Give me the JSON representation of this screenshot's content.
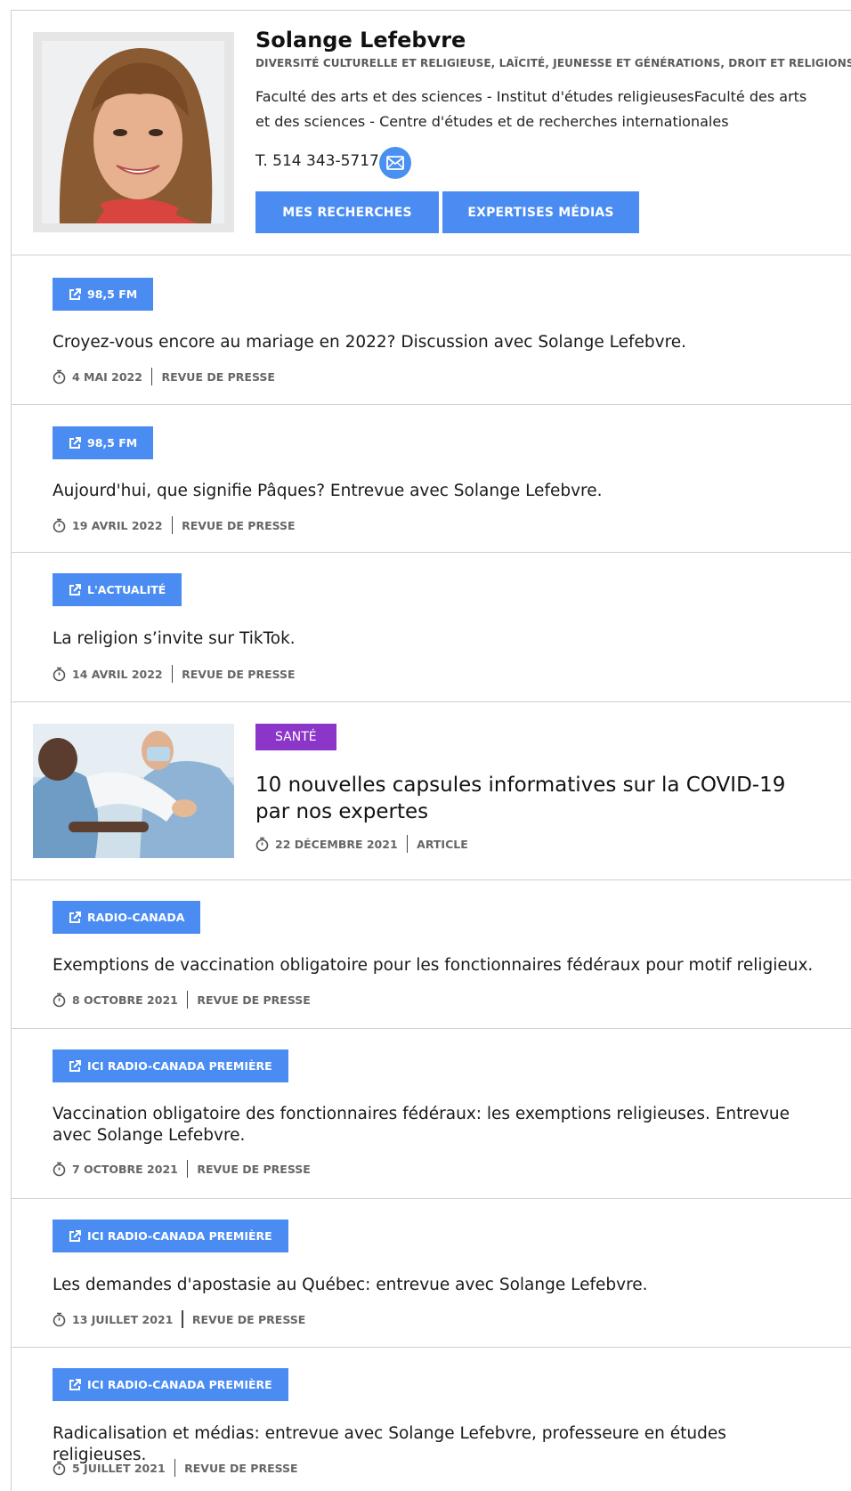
{
  "profile": {
    "name": "Solange Lefebvre",
    "expertise": "DIVERSITÉ CULTURELLE ET RELIGIEUSE, LAÏCITÉ, JEUNESSE ET GÉNÉRATIONS, DROIT ET RELIGIONS",
    "affiliation": "Faculté des arts et des sciences - Institut d'études religieusesFaculté des arts et des sciences - Centre d'études et de recherches internationales",
    "phone": "T. 514 343-5717",
    "mail_icon": "envelope-icon",
    "buttons": {
      "research": "MES RECHERCHES",
      "media": "EXPERTISES MÉDIAS"
    }
  },
  "colors": {
    "accent_blue": "#4a8cf2",
    "sante_purple": "#8b35c9"
  },
  "items": [
    {
      "source": "98,5 FM",
      "title": "Croyez-vous encore au mariage en 2022? Discussion avec Solange Lefebvre.",
      "date": "4 MAI 2022",
      "type": "REVUE DE PRESSE"
    },
    {
      "source": "98,5 FM",
      "title": "Aujourd'hui, que signifie Pâques? Entrevue avec Solange Lefebvre.",
      "date": "19 AVRIL 2022",
      "type": "REVUE DE PRESSE"
    },
    {
      "source": "L'ACTUALITÉ",
      "title": "La religion s’invite sur TikTok.",
      "date": "14 AVRIL 2022",
      "type": "REVUE DE PRESSE"
    },
    {
      "category": "SANTÉ",
      "title": "10 nouvelles capsules informatives sur la COVID-19 par nos expertes",
      "date": "22 DÉCEMBRE 2021",
      "type": "ARTICLE"
    },
    {
      "source": "RADIO-CANADA",
      "title": "Exemptions de vaccination obligatoire pour les fonctionnaires fédéraux pour motif religieux.",
      "date": "8 OCTOBRE 2021",
      "type": "REVUE DE PRESSE"
    },
    {
      "source": "ICI RADIO-CANADA PREMIÈRE",
      "title": "Vaccination obligatoire des fonctionnaires fédéraux: les exemptions religieuses. Entrevue avec Solange Lefebvre.",
      "date": "7 OCTOBRE 2021",
      "type": "REVUE DE PRESSE"
    },
    {
      "source": "ICI RADIO-CANADA PREMIÈRE",
      "title": "Les demandes d'apostasie au Québec: entrevue avec Solange Lefebvre.",
      "date": "13 JUILLET 2021",
      "type": "REVUE DE PRESSE"
    },
    {
      "source": "ICI RADIO-CANADA PREMIÈRE",
      "title": "Radicalisation et médias: entrevue avec Solange Lefebvre, professeure en études religieuses.",
      "date": "5 JUILLET 2021",
      "type": "REVUE DE PRESSE"
    }
  ]
}
